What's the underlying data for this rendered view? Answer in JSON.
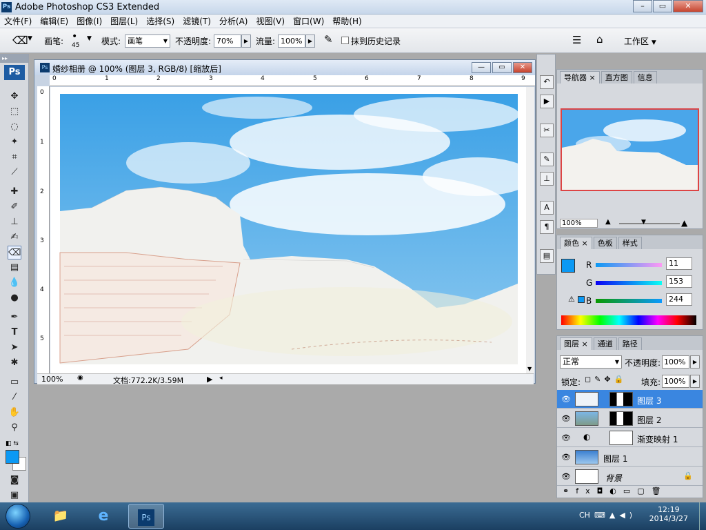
{
  "window": {
    "title": "Adobe Photoshop CS3 Extended",
    "app_icon": "Ps",
    "controls": [
      "–",
      "▭",
      "✕"
    ]
  },
  "menu": [
    "文件(F)",
    "编辑(E)",
    "图像(I)",
    "图层(L)",
    "选择(S)",
    "滤镜(T)",
    "分析(A)",
    "视图(V)",
    "窗口(W)",
    "帮助(H)"
  ],
  "options": {
    "brush_label": "画笔:",
    "brush_size": "45",
    "mode_label": "模式:",
    "mode_value": "画笔",
    "opacity_label": "不透明度:",
    "opacity_value": "70%",
    "flow_label": "流量:",
    "flow_value": "100%",
    "erase_history_label": "抹到历史记录",
    "workspace_label": "工作区"
  },
  "toolbox": {
    "badge": "Ps"
  },
  "document": {
    "title": "婚纱相册 @ 100% (图层 3, RGB/8) [缩放后]",
    "ruler_h": [
      "0",
      "1",
      "2",
      "3",
      "4",
      "5",
      "6",
      "7",
      "8",
      "9"
    ],
    "ruler_v": [
      "0",
      "1",
      "2",
      "3",
      "4",
      "5"
    ],
    "zoom": "100%",
    "doc_size": "文档:772.2K/3.59M"
  },
  "navigator": {
    "tabs": [
      "导航器",
      "直方图",
      "信息"
    ],
    "zoom": "100%"
  },
  "color": {
    "tabs": [
      "颜色",
      "色板",
      "样式"
    ],
    "r_label": "R",
    "r_value": "11",
    "g_label": "G",
    "g_value": "153",
    "b_label": "B",
    "b_value": "244",
    "foreground": "#0b99f4"
  },
  "layers": {
    "tabs": [
      "图层",
      "通道",
      "路径"
    ],
    "blend_mode": "正常",
    "opacity_label": "不透明度:",
    "opacity_value": "100%",
    "lock_label": "锁定:",
    "fill_label": "填充:",
    "fill_value": "100%",
    "items": [
      {
        "name": "图层 3",
        "selected": true
      },
      {
        "name": "图层 2",
        "selected": false
      },
      {
        "name": "渐变映射 1",
        "selected": false
      },
      {
        "name": "图层 1",
        "selected": false
      },
      {
        "name": "背景",
        "selected": false
      }
    ]
  },
  "taskbar": {
    "lang": "CH",
    "time": "12:19",
    "date": "2014/3/27"
  }
}
